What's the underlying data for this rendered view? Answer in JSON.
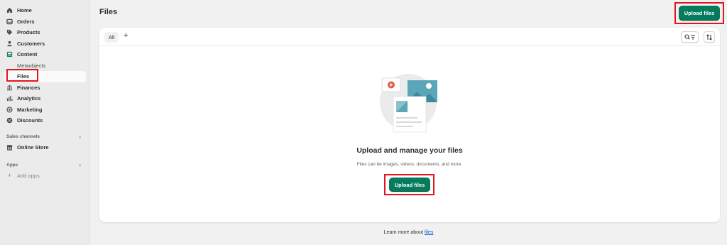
{
  "sidebar": {
    "items": [
      {
        "label": "Home",
        "icon": "home-icon"
      },
      {
        "label": "Orders",
        "icon": "orders-icon"
      },
      {
        "label": "Products",
        "icon": "tag-icon"
      },
      {
        "label": "Customers",
        "icon": "person-icon"
      },
      {
        "label": "Content",
        "icon": "content-icon"
      }
    ],
    "content_sub": [
      "Metaobjects",
      "Files"
    ],
    "items2": [
      {
        "label": "Finances",
        "icon": "bank-icon"
      },
      {
        "label": "Analytics",
        "icon": "chart-icon"
      },
      {
        "label": "Marketing",
        "icon": "target-icon"
      },
      {
        "label": "Discounts",
        "icon": "discount-icon"
      }
    ],
    "sales_channels": "Sales channels",
    "online_store": "Online Store",
    "apps": "Apps",
    "add_apps": "Add apps"
  },
  "page": {
    "title": "Files",
    "upload_label": "Upload files"
  },
  "tabs": {
    "all": "All",
    "add": "+"
  },
  "empty": {
    "title": "Upload and manage your files",
    "description": "Files can be images, videos, documents, and more.",
    "upload_label": "Upload files"
  },
  "footer": {
    "text": "Learn more about",
    "link": "files"
  },
  "colors": {
    "accent": "#047b5d",
    "highlight": "#e3141c",
    "link": "#005bd3"
  }
}
